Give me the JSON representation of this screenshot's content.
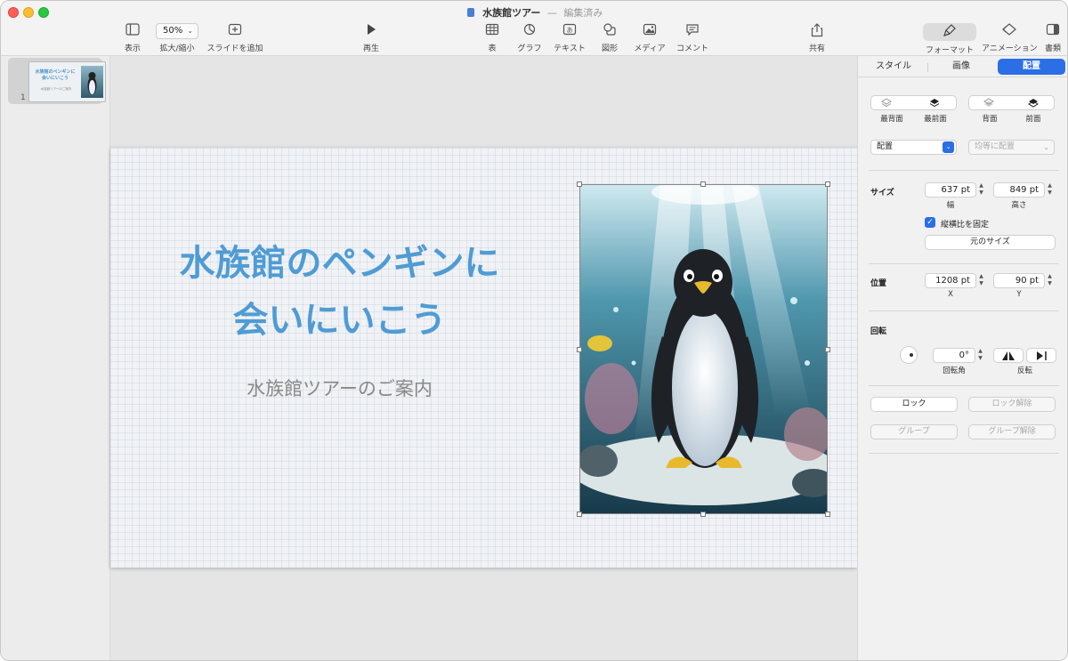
{
  "window": {
    "title": "水族館ツアー",
    "separator": "—",
    "status": "編集済み"
  },
  "toolbar": {
    "view_label": "表示",
    "zoom_value": "50%",
    "zoom_label": "拡大/縮小",
    "add_slide_label": "スライドを追加",
    "play_label": "再生",
    "table_label": "表",
    "chart_label": "グラフ",
    "text_label": "テキスト",
    "shape_label": "図形",
    "media_label": "メディア",
    "comment_label": "コメント",
    "share_label": "共有",
    "format_label": "フォーマット",
    "animate_label": "アニメーション",
    "document_label": "書類"
  },
  "navigator": {
    "slide_number": "1"
  },
  "slide": {
    "title_line1": "水族館のペンギンに",
    "title_line2": "会いにいこう",
    "subtitle": "水族館ツアーのご案内"
  },
  "inspector": {
    "tabs": [
      "スタイル",
      "画像",
      "配置"
    ],
    "active_tab": "配置",
    "layer_buttons": [
      "最背面",
      "最前面",
      "背面",
      "前面"
    ],
    "align_select": "配置",
    "distribute_select": "均等に配置",
    "size_label": "サイズ",
    "width_value": "637 pt",
    "width_caption": "幅",
    "height_value": "849 pt",
    "height_caption": "高さ",
    "constrain_label": "縦横比を固定",
    "original_size_label": "元のサイズ",
    "position_label": "位置",
    "x_value": "1208 pt",
    "x_caption": "X",
    "y_value": "90 pt",
    "y_caption": "Y",
    "rotate_label": "回転",
    "angle_value": "0°",
    "angle_caption": "回転角",
    "flip_caption": "反転",
    "lock_label": "ロック",
    "unlock_label": "ロック解除",
    "group_label": "グループ",
    "ungroup_label": "グループ解除"
  },
  "colors": {
    "accent": "#2a6fe5",
    "title_blue": "#4f9cd4"
  }
}
